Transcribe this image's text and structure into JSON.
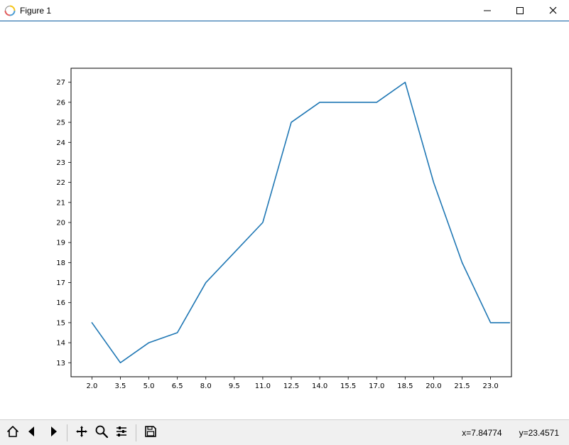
{
  "window": {
    "title": "Figure 1"
  },
  "toolbar": {
    "home": "Home",
    "back": "Back",
    "forward": "Forward",
    "pan": "Pan",
    "zoom": "Zoom",
    "configure": "Configure subplots",
    "save": "Save"
  },
  "status": {
    "x_label": "x=7.84774",
    "y_label": "y=23.4571"
  },
  "chart_data": {
    "type": "line",
    "x": [
      2.0,
      3.5,
      5.0,
      6.5,
      8.0,
      9.5,
      11.0,
      12.5,
      14.0,
      15.5,
      17.0,
      18.5,
      20.0,
      21.5,
      23.0,
      24.0
    ],
    "y": [
      15,
      13,
      14,
      14.5,
      17,
      18.5,
      20,
      25,
      26,
      26,
      26,
      27,
      22,
      18,
      15,
      15
    ],
    "xticks": [
      "2.0",
      "3.5",
      "5.0",
      "6.5",
      "8.0",
      "9.5",
      "11.0",
      "12.5",
      "14.0",
      "15.5",
      "17.0",
      "18.5",
      "20.0",
      "21.5",
      "23.0"
    ],
    "yticks": [
      "13",
      "14",
      "15",
      "16",
      "17",
      "18",
      "19",
      "20",
      "21",
      "22",
      "23",
      "24",
      "25",
      "26",
      "27"
    ],
    "title": "",
    "xlabel": "",
    "ylabel": "",
    "xlim": [
      0.9,
      24.1
    ],
    "ylim": [
      12.3,
      27.7
    ],
    "line_color": "#1f77b4"
  }
}
